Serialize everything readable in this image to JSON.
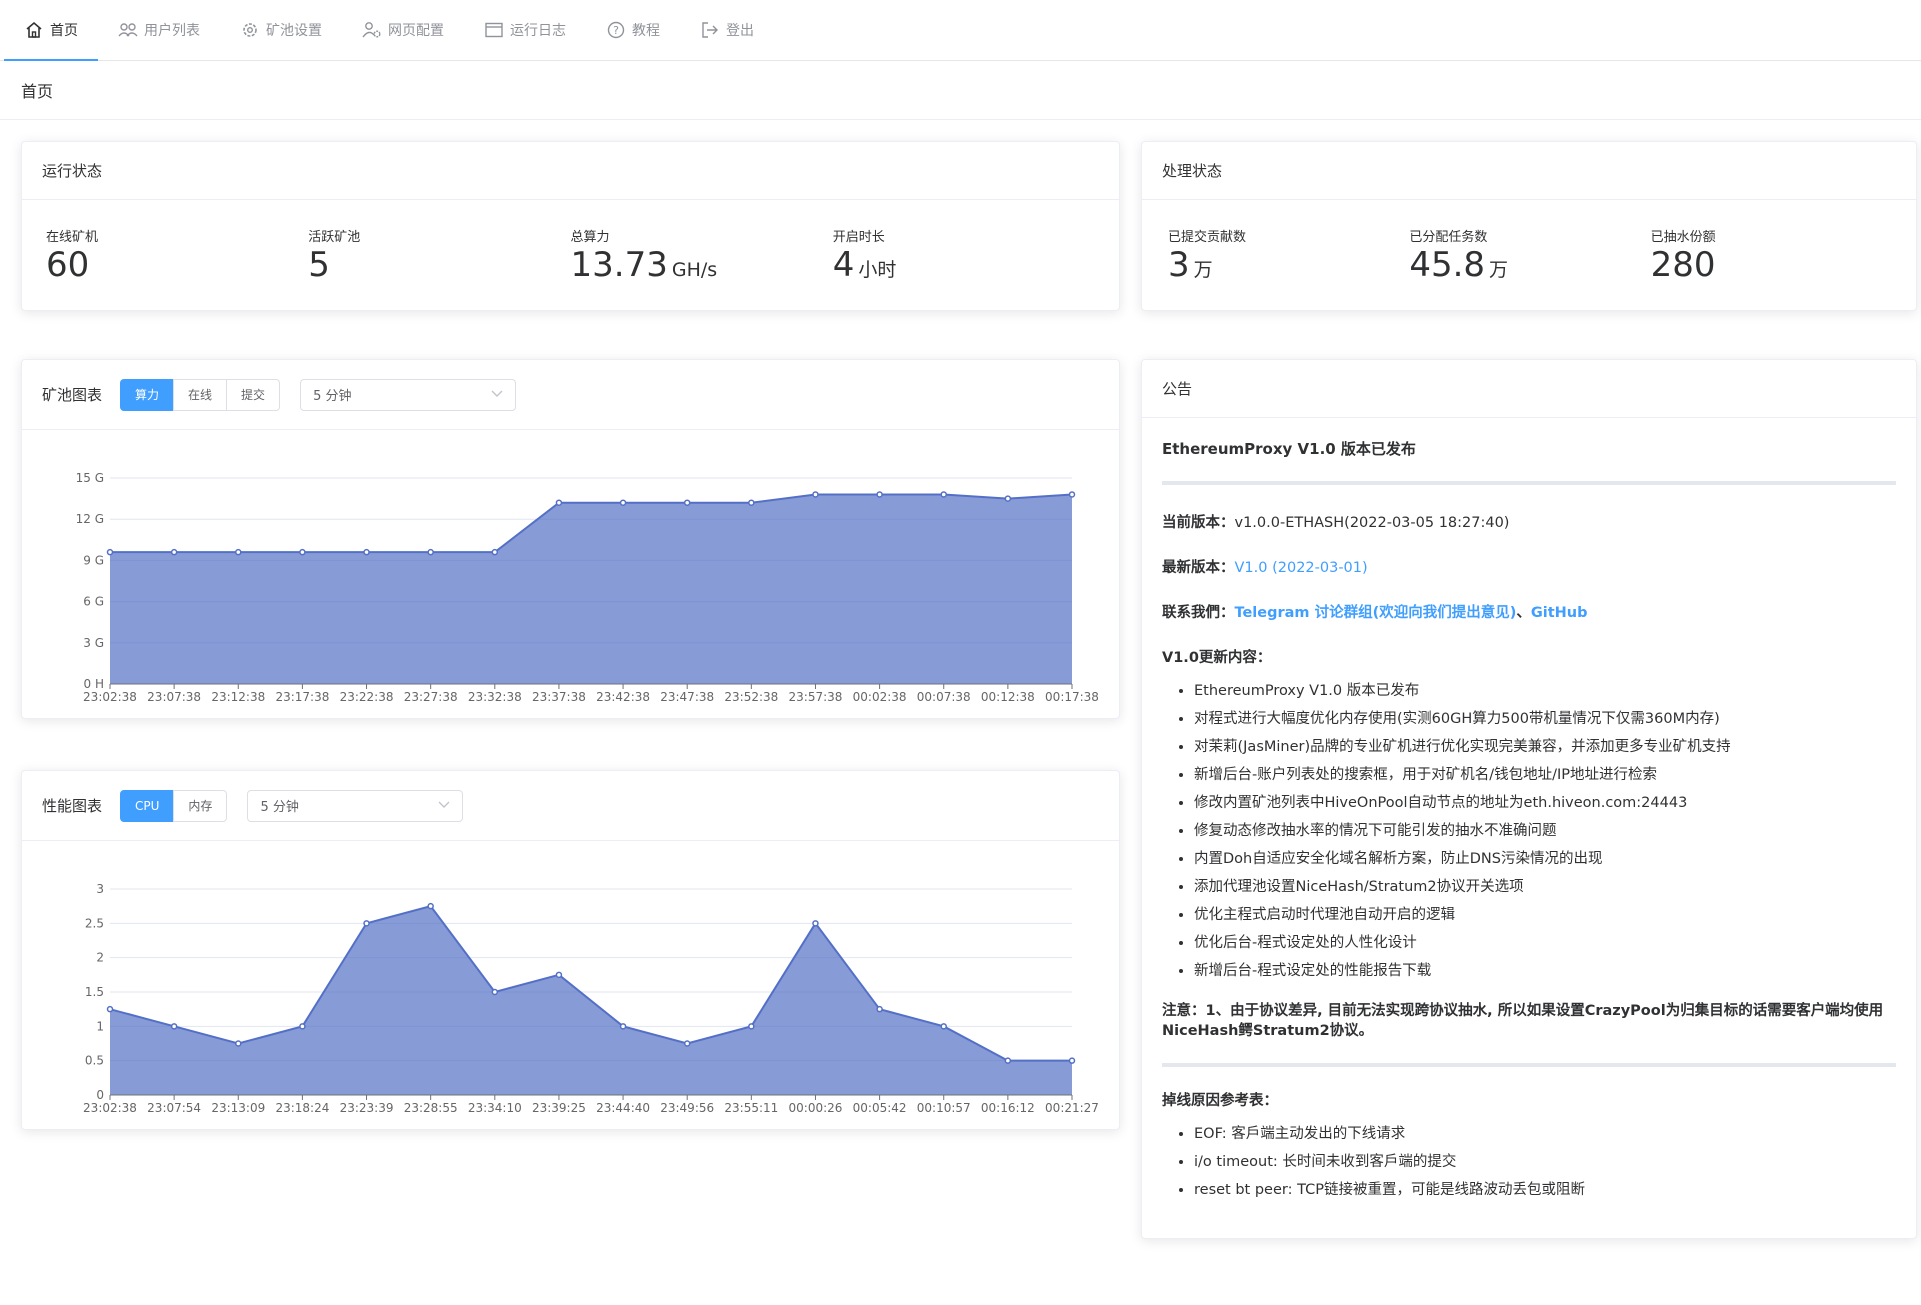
{
  "nav": {
    "items": [
      {
        "label": "首页",
        "icon": "home-icon"
      },
      {
        "label": "用户列表",
        "icon": "users-icon"
      },
      {
        "label": "矿池设置",
        "icon": "gear-icon"
      },
      {
        "label": "网页配置",
        "icon": "user-settings-icon"
      },
      {
        "label": "运行日志",
        "icon": "log-window-icon"
      },
      {
        "label": "教程",
        "icon": "help-icon"
      },
      {
        "label": "登出",
        "icon": "logout-icon"
      }
    ]
  },
  "breadcrumb": "首页",
  "running_status": {
    "title": "运行状态",
    "stats": [
      {
        "label": "在线矿机",
        "value": "60",
        "unit": ""
      },
      {
        "label": "活跃矿池",
        "value": "5",
        "unit": ""
      },
      {
        "label": "总算力",
        "value": "13.73",
        "unit": "GH/s"
      },
      {
        "label": "开启时长",
        "value": "4",
        "unit": "小时"
      }
    ]
  },
  "process_status": {
    "title": "处理状态",
    "stats": [
      {
        "label": "已提交贡献数",
        "value": "3",
        "unit": "万"
      },
      {
        "label": "已分配任务数",
        "value": "45.8",
        "unit": "万"
      },
      {
        "label": "已抽水份额",
        "value": "280",
        "unit": ""
      }
    ]
  },
  "pool_chart": {
    "title": "矿池图表",
    "tabs": [
      "算力",
      "在线",
      "提交"
    ],
    "active_tab": 0,
    "select": "5 分钟"
  },
  "perf_chart": {
    "title": "性能图表",
    "tabs": [
      "CPU",
      "内存"
    ],
    "active_tab": 0,
    "select": "5 分钟"
  },
  "chart_data": [
    {
      "type": "area",
      "x": [
        "23:02:38",
        "23:07:38",
        "23:12:38",
        "23:17:38",
        "23:22:38",
        "23:27:38",
        "23:32:38",
        "23:37:38",
        "23:42:38",
        "23:47:38",
        "23:52:38",
        "23:57:38",
        "00:02:38",
        "00:07:38",
        "00:12:38",
        "00:17:38"
      ],
      "values": [
        9.6,
        9.6,
        9.6,
        9.6,
        9.6,
        9.6,
        9.6,
        13.2,
        13.2,
        13.2,
        13.2,
        13.8,
        13.8,
        13.8,
        13.5,
        13.8
      ],
      "yticks": [
        "0 H",
        "3 G",
        "6 G",
        "9 G",
        "12 G",
        "15 G"
      ],
      "ylim": [
        0,
        15
      ],
      "color": "#5470c6"
    },
    {
      "type": "area",
      "x": [
        "23:02:38",
        "23:07:54",
        "23:13:09",
        "23:18:24",
        "23:23:39",
        "23:28:55",
        "23:34:10",
        "23:39:25",
        "23:44:40",
        "23:49:56",
        "23:55:11",
        "00:00:26",
        "00:05:42",
        "00:10:57",
        "00:16:12",
        "00:21:27"
      ],
      "values": [
        1.25,
        1.0,
        0.75,
        1.0,
        2.5,
        2.75,
        1.5,
        1.75,
        1.0,
        0.75,
        1.0,
        2.5,
        1.25,
        1.0,
        0.5,
        0.5
      ],
      "yticks": [
        "0",
        "0.5",
        "1",
        "1.5",
        "2",
        "2.5",
        "3"
      ],
      "ylim": [
        0,
        3
      ],
      "color": "#5470c6"
    }
  ],
  "notice": {
    "title": "公告",
    "heading": "EthereumProxy V1.0 版本已发布",
    "current_version_label": "当前版本：",
    "current_version": "v1.0.0-ETHASH(2022-03-05 18:27:40)",
    "latest_version_label": "最新版本：",
    "latest_version": "V1.0 (2022-03-01)",
    "contact_label": "联系我們：",
    "contact_telegram": "Telegram 讨论群组(欢迎向我们提出意见)",
    "contact_sep": "、",
    "contact_github": "GitHub",
    "changelog_title": "V1.0更新内容：",
    "changelog": [
      "EthereumProxy V1.0 版本已发布",
      "对程式进行大幅度优化内存使用(实测60GH算力500带机量情况下仅需360M内存)",
      "对茉莉(JasMiner)品牌的专业矿机进行优化实现完美兼容，并添加更多专业矿机支持",
      "新增后台-账户列表处的搜索框，用于对矿机名/钱包地址/IP地址进行检索",
      "修改内置矿池列表中HiveOnPool自动节点的地址为eth.hiveon.com:24443",
      "修复动态修改抽水率的情况下可能引发的抽水不准确问题",
      "内置Doh自适应安全化域名解析方案，防止DNS污染情况的出现",
      "添加代理池设置NiceHash/Stratum2协议开关选项",
      "优化主程式启动时代理池自动开启的逻辑",
      "优化后台-程式设定处的人性化设计",
      "新增后台-程式设定处的性能报告下载"
    ],
    "note": "注意：1、由于协议差异, 目前无法实现跨协议抽水, 所以如果设置CrazyPool为归集目标的话需要客户端均使用NiceHash鳄Stratum2协议。",
    "drop_title": "掉线原因参考表：",
    "drop_reasons": [
      "EOF: 客戶端主动发出的下线请求",
      "i/o timeout: 长时间未收到客戶端的提交",
      "reset bt peer: TCP链接被重置，可能是线路波动丢包或阻断"
    ]
  }
}
